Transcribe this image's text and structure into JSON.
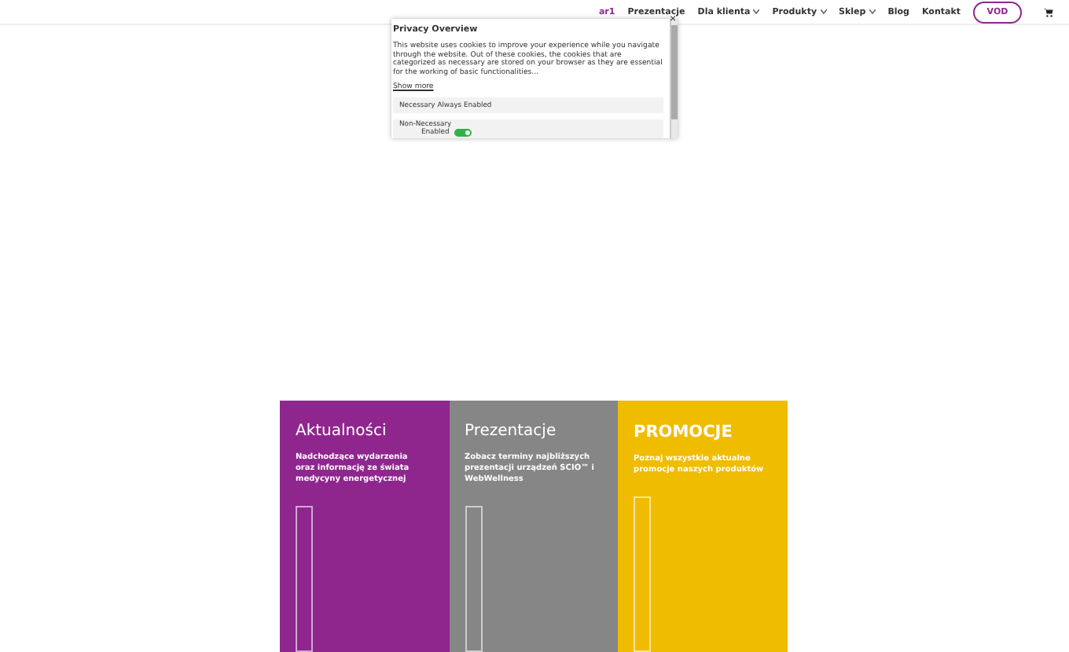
{
  "header": {
    "nav": [
      {
        "label": "ar1",
        "selected": true,
        "dropdown": false
      },
      {
        "label": "Prezentacje",
        "selected": false,
        "dropdown": false
      },
      {
        "label": "Dla klienta",
        "selected": false,
        "dropdown": true
      },
      {
        "label": "Produkty",
        "selected": false,
        "dropdown": true
      },
      {
        "label": "Sklep",
        "selected": false,
        "dropdown": true
      },
      {
        "label": "Blog",
        "selected": false,
        "dropdown": false
      },
      {
        "label": "Kontakt",
        "selected": false,
        "dropdown": false
      }
    ],
    "vod_button": "VOD"
  },
  "cookie_popup": {
    "title": "Privacy Overview",
    "close": "×",
    "text": "This website uses cookies to improve your experience while you navigate through the website. Out of these cookies, the cookies that are categorized as necessary are stored on your browser as they are essential for the working of basic functionalities...",
    "show_more": "Show more",
    "sections": [
      {
        "kind": "fixed",
        "title": "Necessary",
        "status": "Always Enabled"
      },
      {
        "kind": "toggle",
        "title": "Non-Necessary",
        "status": "Enabled",
        "on": true
      }
    ]
  },
  "cards": [
    {
      "title": "Aktualności",
      "text": "Nadchodzące wydarzenia oraz informację ze świata medycyny energetycznej",
      "color": "#8e268d",
      "bold": false
    },
    {
      "title": "Prezentacje",
      "text": "Zobacz terminy najbliższych prezentacji urządzeń SCIO™ i WebWellness",
      "color": "#868686",
      "bold": false
    },
    {
      "title": "PROMOCJE",
      "text": "Poznaj wszystkie aktualne promocje naszych produktów",
      "color": "#f0bc00",
      "bold": true
    }
  ]
}
